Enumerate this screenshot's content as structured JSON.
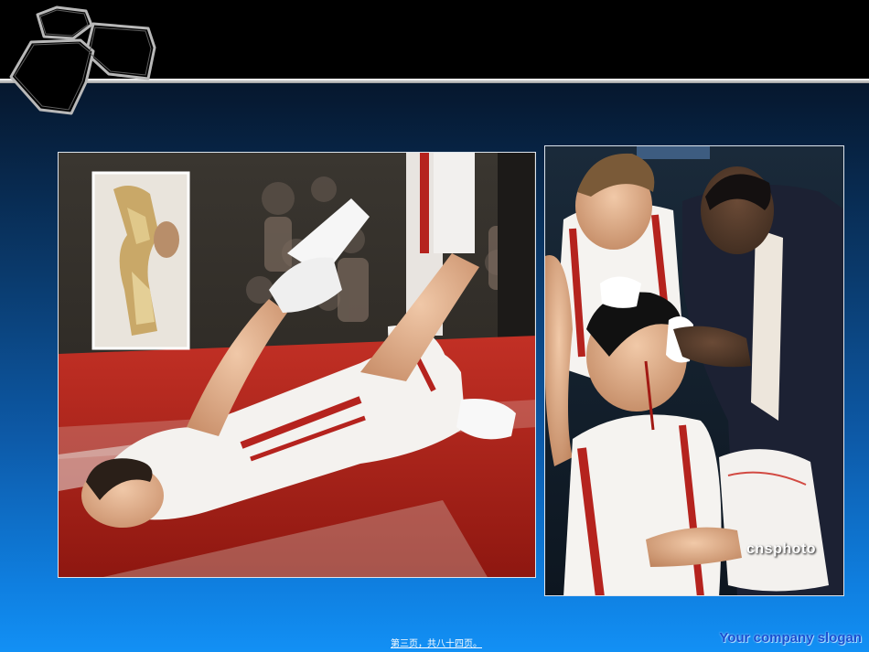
{
  "photos": {
    "left": {
      "subject": "injured basketball player lying on court with inset of ankle bone",
      "inset": "ankle bone x-ray inset"
    },
    "right": {
      "subject": "player with facial injury attended by teammate and staff",
      "watermark": "cnsphoto"
    }
  },
  "footer": {
    "page_label": "第三页，共八十四页。",
    "slogan": "Your company slogan"
  },
  "colors": {
    "slogan": "#1a4fd0",
    "background_top": "#050c16",
    "background_bottom": "#1290f5"
  }
}
